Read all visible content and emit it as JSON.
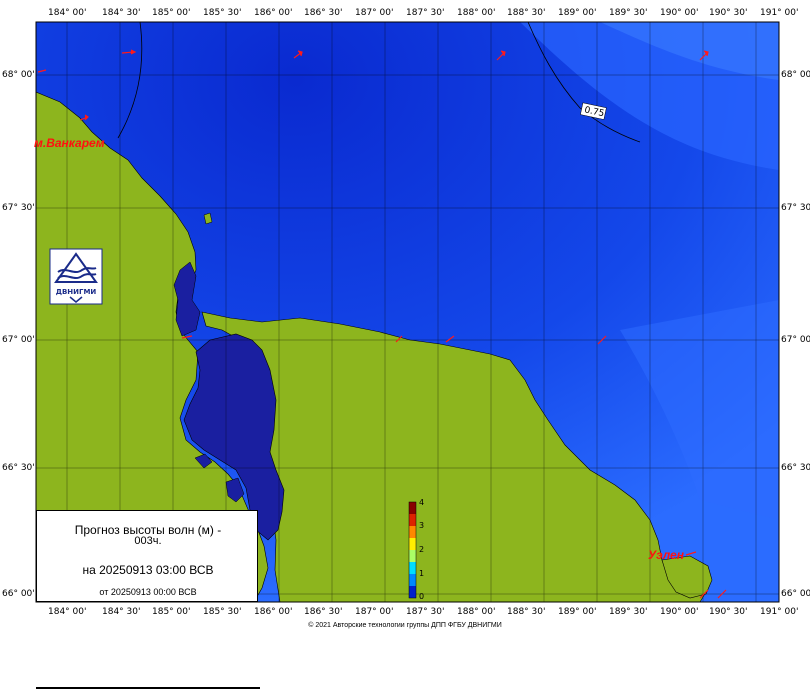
{
  "top_lon_labels": [
    "184° 00'",
    "184° 30'",
    "185° 00'",
    "185° 30'",
    "186° 00'",
    "186° 30'",
    "187° 00'",
    "187° 30'",
    "188° 00'",
    "188° 30'",
    "189° 00'",
    "189° 30'",
    "190° 00'",
    "190° 30'",
    "191° 00'"
  ],
  "bottom_lon_labels": [
    "184° 00'",
    "184° 30'",
    "185° 00'",
    "185° 30'",
    "186° 00'",
    "186° 30'",
    "187° 00'",
    "187° 30'",
    "188° 00'",
    "188° 30'",
    "189° 00'",
    "189° 30'",
    "190° 00'",
    "190° 30'",
    "191° 00'"
  ],
  "lat_labels": [
    "68° 00'",
    "67° 30'",
    "67° 00'",
    "66° 30'",
    "66° 00'"
  ],
  "places": {
    "vankarem": "м.Ванкарем",
    "uelen": "Уэлен"
  },
  "contour_label": "0.75",
  "logo": {
    "text": "ДВНИГМИ"
  },
  "colorbar": {
    "ticks": [
      "4",
      "3",
      "2",
      "1",
      "0"
    ],
    "colors": [
      "#0000aa",
      "#0044ff",
      "#00ccff",
      "#66ff66",
      "#ffff00",
      "#ff8800",
      "#cc0000",
      "#880000"
    ]
  },
  "forecast": {
    "title": "Прогноз высоты волн (м) -",
    "lead": "003ч.",
    "valid": "на 20250913 03:00 ВСВ",
    "issued": "от 20250913 00:00 ВСВ"
  },
  "footer": "© 2021 Авторские технологии группы ДПП ФГБУ ДВНИГМИ",
  "colors": {
    "land": "#8db51e",
    "sea_dark": "#0a2fd0",
    "sea_mid": "#1450ef",
    "sea_light": "#2a6bff",
    "lagoon": "#1a1fa0"
  }
}
